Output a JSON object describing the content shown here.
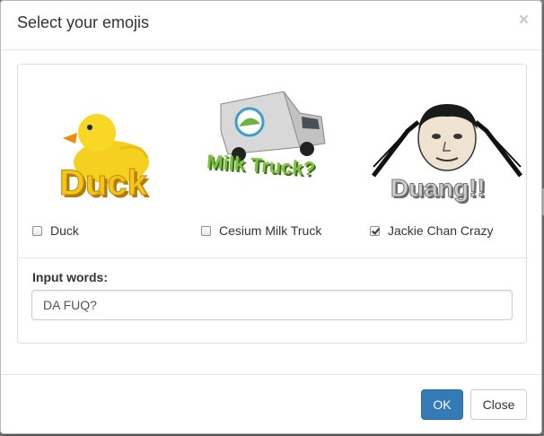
{
  "dialog": {
    "title": "Select your emojis",
    "close_symbol": "×"
  },
  "emojis": [
    {
      "label": "Duck",
      "checked": false,
      "image_text": "Duck",
      "icon": "rubber-duck-icon"
    },
    {
      "label": "Cesium Milk Truck",
      "checked": false,
      "image_text": "Milk Truck?",
      "icon": "milk-truck-icon"
    },
    {
      "label": "Jackie Chan Crazy",
      "checked": true,
      "image_text": "Duang!!",
      "icon": "jackie-chan-face-icon"
    }
  ],
  "input": {
    "label": "Input words:",
    "value": "DA FUQ?"
  },
  "footer": {
    "ok_label": "OK",
    "close_label": "Close"
  },
  "colors": {
    "primary": "#337ab7",
    "duck_yellow": "#f5d020",
    "truck_text_green": "#6fb53a"
  }
}
